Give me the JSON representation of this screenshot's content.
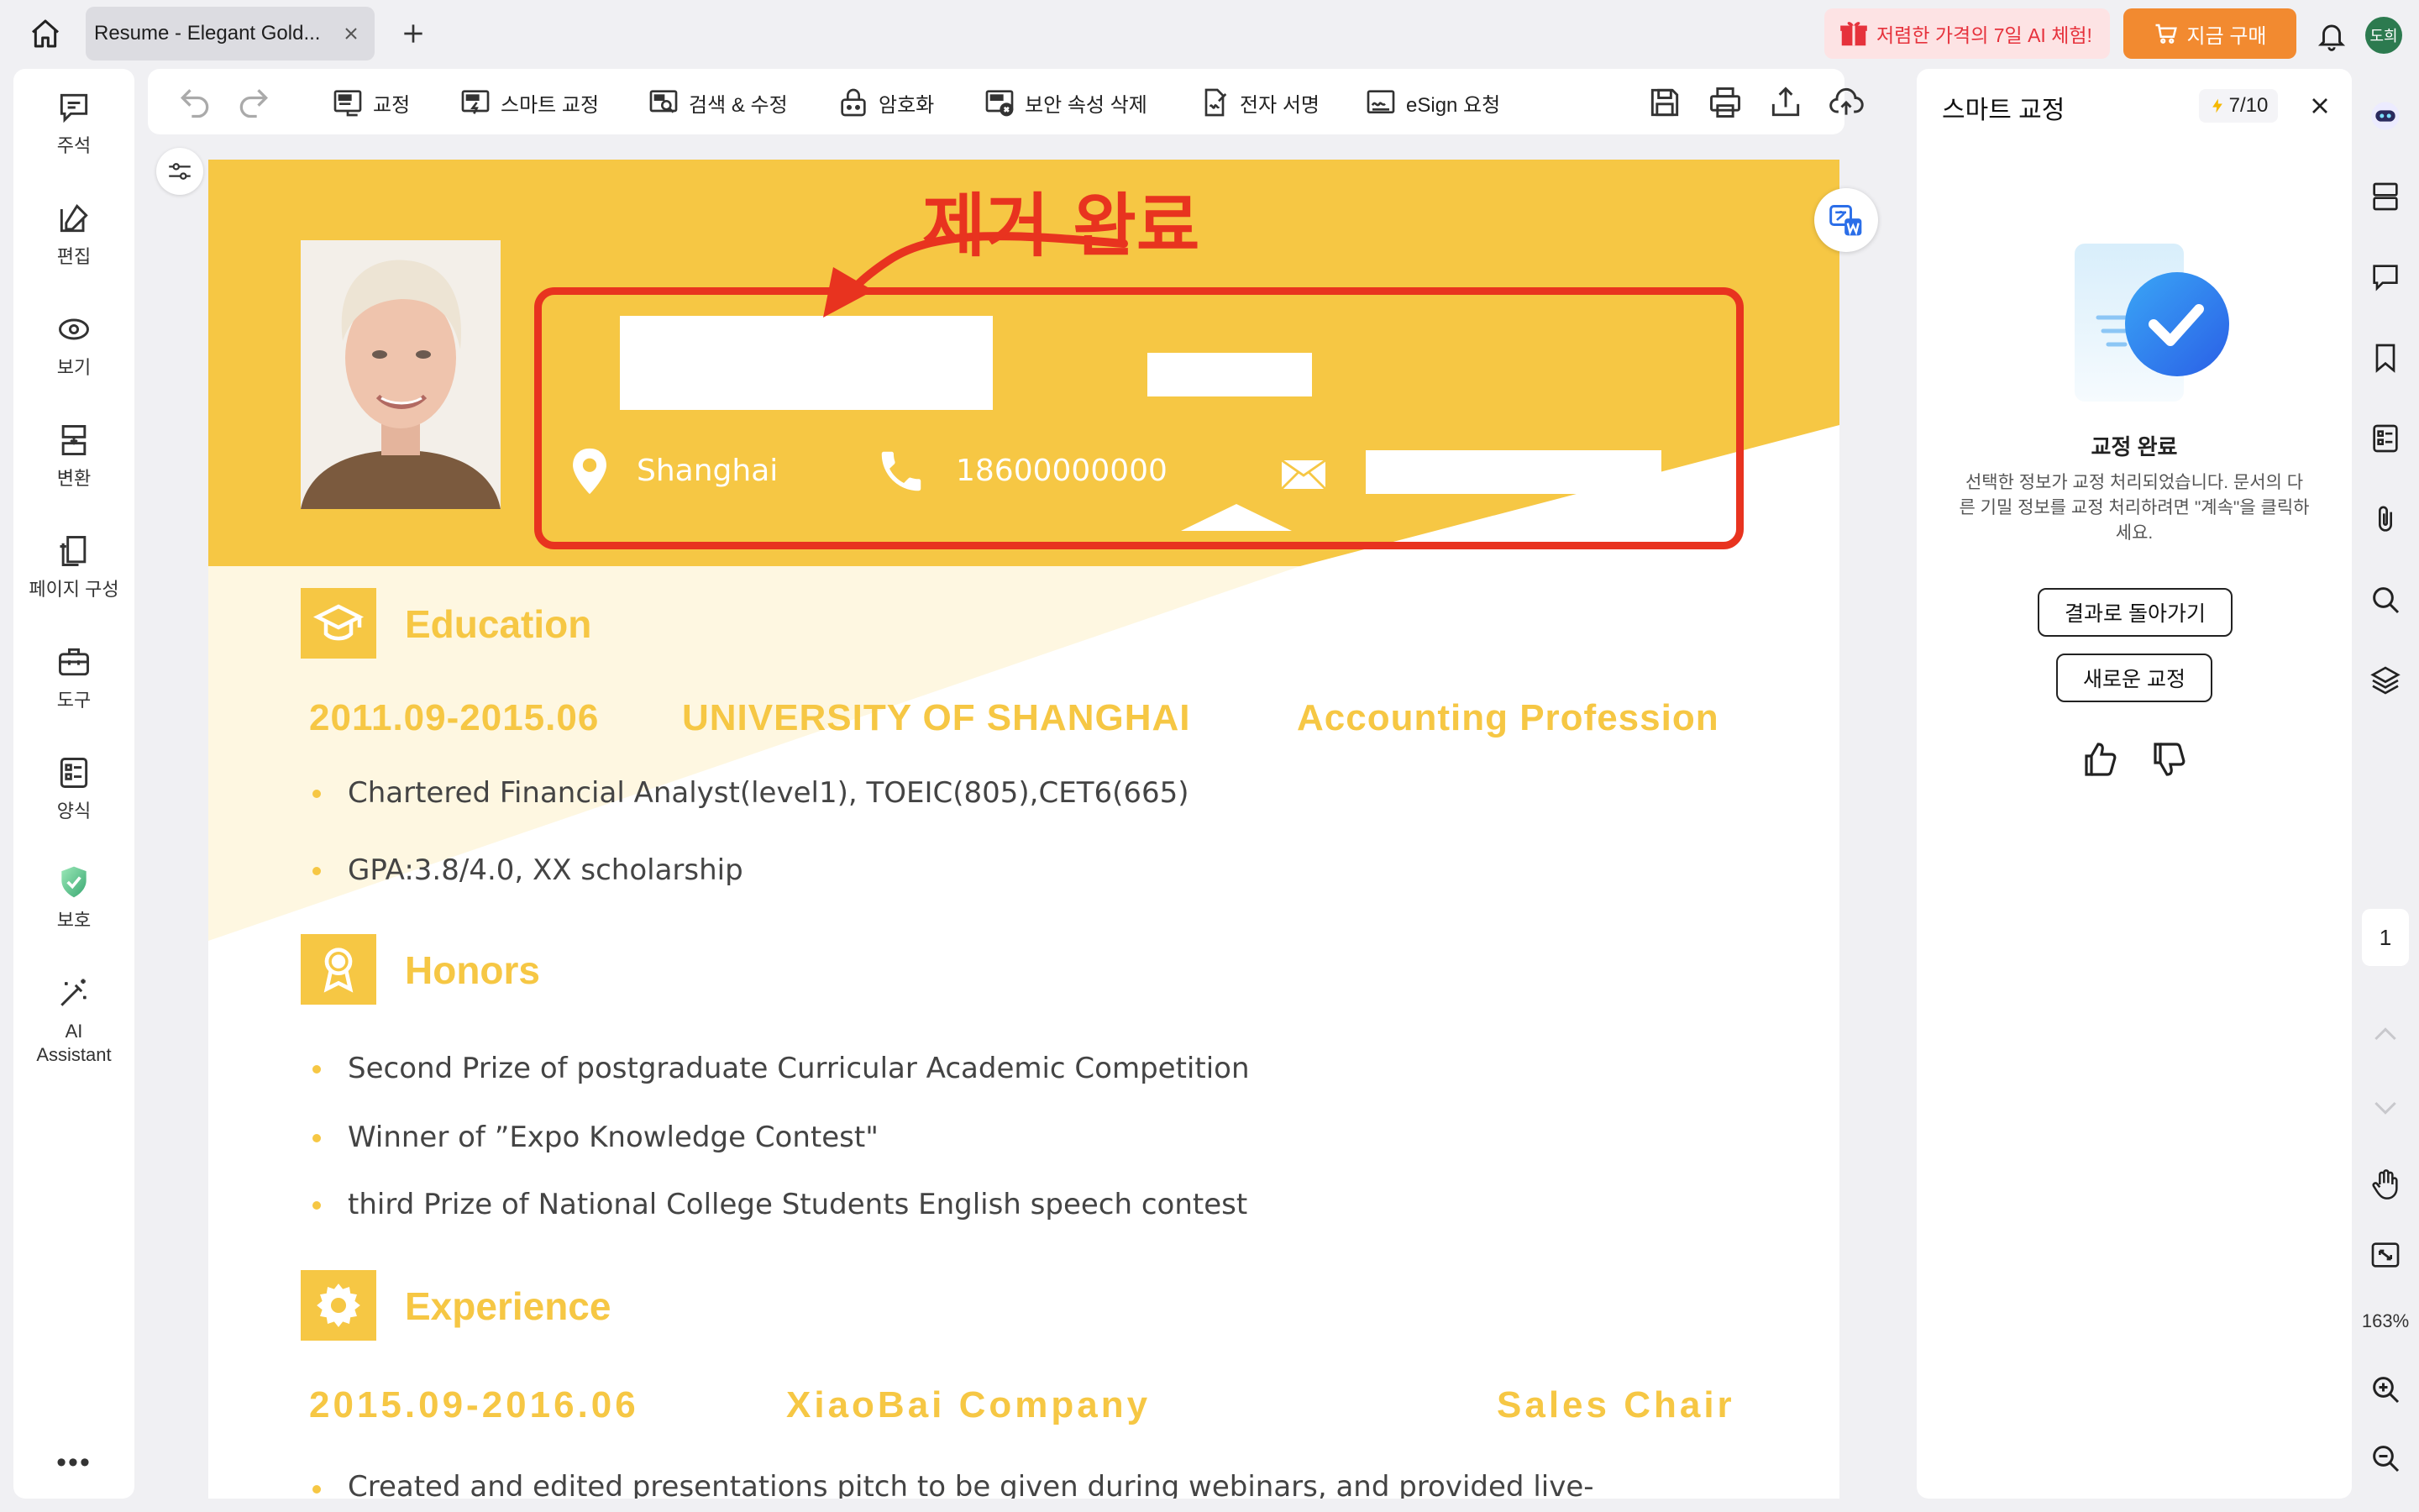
{
  "tab": {
    "title": "Resume - Elegant Gold..."
  },
  "promo": {
    "text": "저렴한 가격의 7일 AI 체험!"
  },
  "buy": {
    "label": "지금 구매"
  },
  "user": {
    "avatar_text": "도희"
  },
  "sidebar": {
    "items": [
      {
        "label": "주석",
        "icon": "comment-icon"
      },
      {
        "label": "편집",
        "icon": "edit-icon"
      },
      {
        "label": "보기",
        "icon": "eye-icon"
      },
      {
        "label": "변환",
        "icon": "convert-icon"
      },
      {
        "label": "페이지 구성",
        "icon": "page-organize-icon"
      },
      {
        "label": "도구",
        "icon": "toolbox-icon"
      },
      {
        "label": "양식",
        "icon": "form-icon"
      },
      {
        "label": "보호",
        "icon": "shield-icon"
      },
      {
        "label": "AI Assistant",
        "icon": "ai-wand-icon"
      }
    ],
    "more": "•••"
  },
  "toolbar": {
    "redact": "교정",
    "smart_redact": "스마트 교정",
    "search_redact": "검색 & 수정",
    "encrypt": "암호화",
    "remove_hidden": "보안 속성 삭제",
    "esign": "전자 서명",
    "esign_request": "eSign 요청"
  },
  "document": {
    "annotation": "제거 완료",
    "location": "Shanghai",
    "phone": "18600000000",
    "sections": {
      "education": {
        "title": "Education",
        "period": "2011.09-2015.06",
        "school": "UNIVERSITY OF SHANGHAI",
        "major": "Accounting Profession",
        "items": [
          "Chartered Financial Analyst(level1), TOEIC(805),CET6(665)",
          "GPA:3.8/4.0, XX scholarship"
        ]
      },
      "honors": {
        "title": "Honors",
        "items": [
          "Second Prize of postgraduate Curricular Academic Competition",
          "Winner of ”Expo Knowledge Contest\"",
          "third Prize of National College Students English speech contest"
        ]
      },
      "experience": {
        "title": "Experience",
        "period": "2015.09-2016.06",
        "company": "XiaoBai Company",
        "role": "Sales Chair",
        "items": [
          "Created and edited presentations pitch to be given during webinars, and provided live-"
        ]
      }
    }
  },
  "panel": {
    "title": "스마트 교정",
    "credits": "7/10",
    "heading": "교정 완료",
    "description": "선택한 정보가 교정 처리되었습니다. 문서의 다른 기밀 정보를 교정 처리하려면 \"계속\"을 클릭하세요.",
    "back_button": "결과로 돌아가기",
    "new_button": "새로운 교정"
  },
  "rail": {
    "page": "1",
    "zoom": "163%"
  },
  "colors": {
    "accent_gold": "#f6c744",
    "annotation_red": "#e8331f",
    "buy_orange": "#f28a30",
    "promo_red": "#e6323c"
  }
}
